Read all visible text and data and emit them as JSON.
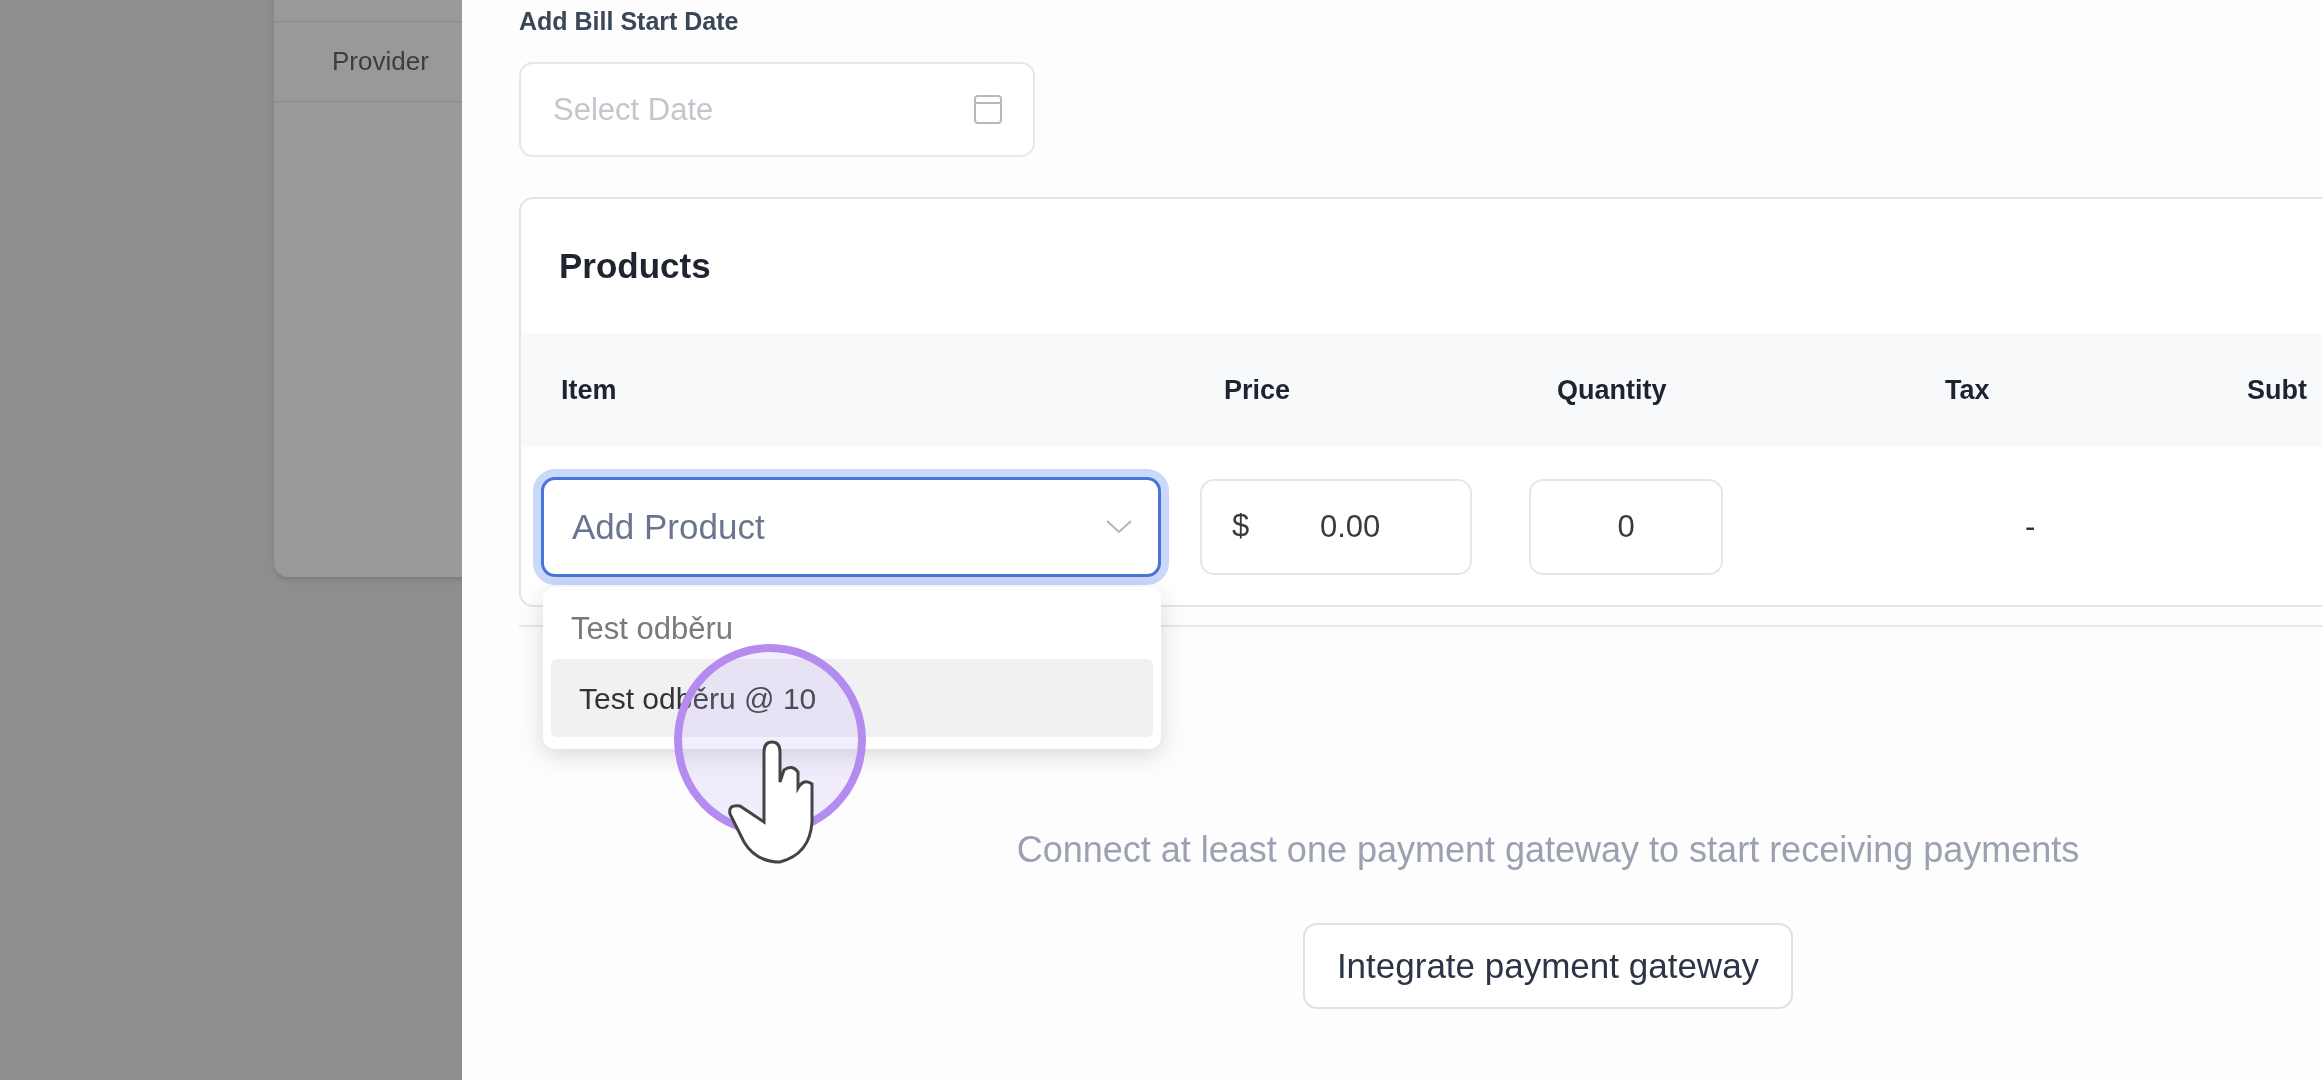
{
  "background": {
    "column_heading": "Provider"
  },
  "start_date": {
    "label": "Add Bill Start Date",
    "placeholder": "Select Date"
  },
  "products": {
    "title": "Products",
    "columns": [
      "Item",
      "Price",
      "Quantity",
      "Tax",
      "Subt"
    ],
    "row": {
      "item_placeholder": "Add Product",
      "currency": "$",
      "price": "0.00",
      "quantity": "0",
      "tax": "-",
      "focused": true
    },
    "dropdown": {
      "open": true,
      "options": [
        {
          "label": "Test odběru",
          "kind": "group"
        },
        {
          "label": "Test odběru @ 10",
          "kind": "option",
          "selected": true
        }
      ]
    }
  },
  "payment": {
    "message": "Connect at least one payment gateway to start receiving payments",
    "button": "Integrate payment gateway"
  }
}
